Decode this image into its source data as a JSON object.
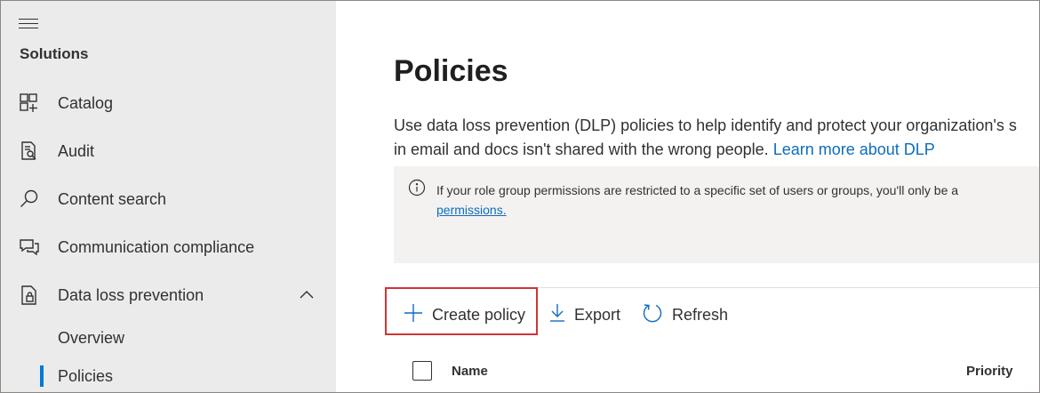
{
  "sidebar": {
    "section_title": "Solutions",
    "items": [
      {
        "label": "Catalog",
        "icon": "catalog-icon"
      },
      {
        "label": "Audit",
        "icon": "audit-icon"
      },
      {
        "label": "Content search",
        "icon": "search-icon"
      },
      {
        "label": "Communication compliance",
        "icon": "communication-icon"
      },
      {
        "label": "Data loss prevention",
        "icon": "dlp-icon",
        "expanded": true
      }
    ],
    "sub_items": [
      {
        "label": "Overview"
      },
      {
        "label": "Policies",
        "active": true
      }
    ]
  },
  "main": {
    "title": "Policies",
    "description_line1": "Use data loss prevention (DLP) policies to help identify and protect your organization's s",
    "description_line2": "in email and docs isn't shared with the wrong people. ",
    "learn_more": "Learn more about DLP",
    "info_text": "If your role group permissions are restricted to a specific set of users or groups, you'll only be a",
    "info_link": "permissions.",
    "toolbar": {
      "create_label": "Create policy",
      "export_label": "Export",
      "refresh_label": "Refresh"
    },
    "table": {
      "columns": [
        "Name",
        "Priority"
      ]
    }
  },
  "colors": {
    "accent": "#0078d4",
    "link": "#0f6cbd",
    "highlight": "#d13438",
    "sidebar_bg": "#ebebeb"
  }
}
